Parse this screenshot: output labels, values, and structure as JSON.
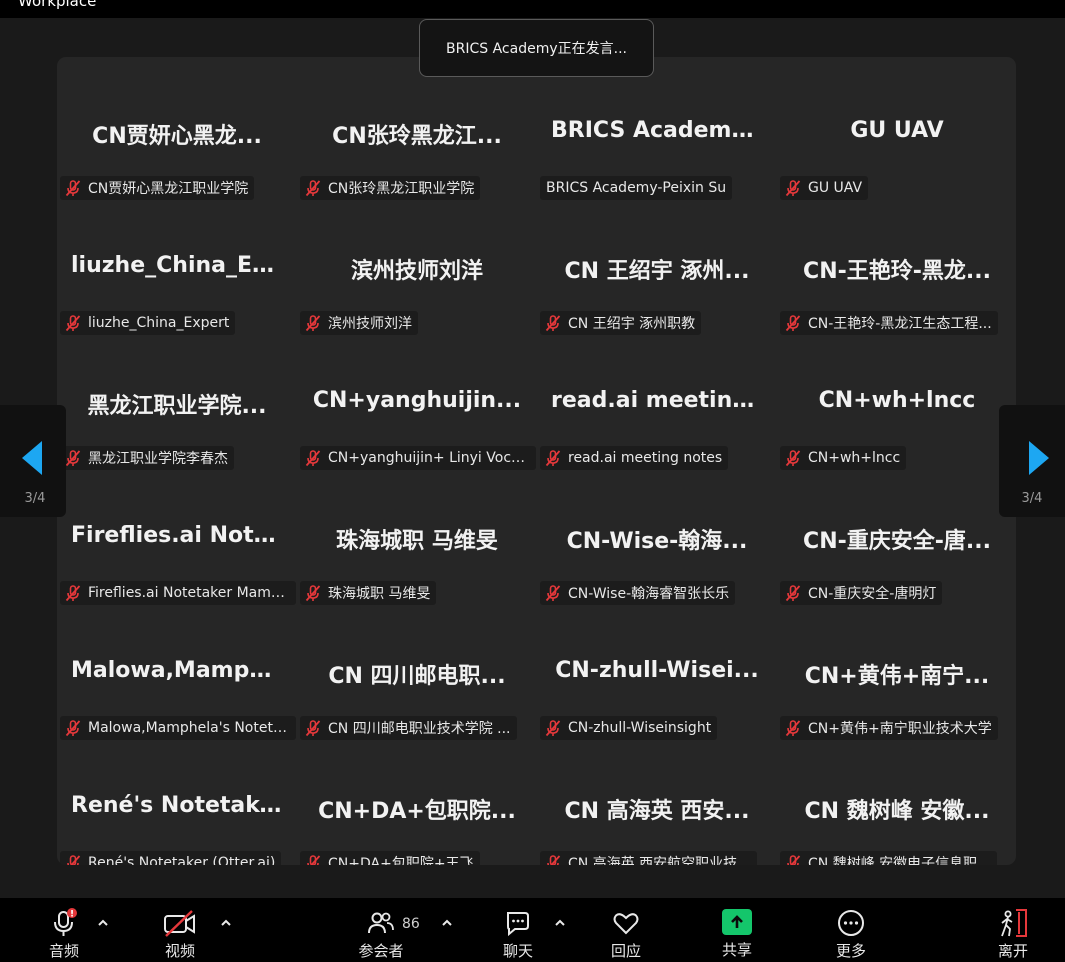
{
  "app": {
    "title": "Workplace"
  },
  "speaker": {
    "banner": "BRICS Academy正在发言..."
  },
  "pagination": {
    "current": "3/4"
  },
  "tiles": [
    {
      "display": "CN贾妍心黑龙...",
      "name": "CN贾妍心黑龙江职业学院",
      "muted": true
    },
    {
      "display": "CN张玲黑龙江...",
      "name": "CN张玲黑龙江职业学院",
      "muted": true
    },
    {
      "display": "BRICS  Academy...",
      "name": "BRICS Academy-Peixin Su",
      "muted": false
    },
    {
      "display": "GU UAV",
      "name": "GU UAV",
      "muted": true
    },
    {
      "display": "liuzhe_China_Ex...",
      "name": "liuzhe_China_Expert",
      "muted": true
    },
    {
      "display": "滨州技师刘洋",
      "name": "滨州技师刘洋",
      "muted": true
    },
    {
      "display": "CN 王绍宇 涿州...",
      "name": "CN 王绍宇 涿州职教",
      "muted": true
    },
    {
      "display": "CN-王艳玲-黑龙...",
      "name": "CN-王艳玲-黑龙江生态工程...",
      "muted": true
    },
    {
      "display": "黑龙江职业学院...",
      "name": "黑龙江职业学院李春杰",
      "muted": true
    },
    {
      "display": "CN+yanghuijin...",
      "name": "CN+yanghuijin+ Linyi Vocat...",
      "muted": true
    },
    {
      "display": "read.ai  meeting...",
      "name": "read.ai meeting notes",
      "muted": true
    },
    {
      "display": "CN+wh+lncc",
      "name": "CN+wh+lncc",
      "muted": true
    },
    {
      "display": "Fireflies.ai  Note...",
      "name": "Fireflies.ai Notetaker Mamp...",
      "muted": true
    },
    {
      "display": "珠海城职 马维旻",
      "name": "珠海城职 马维旻",
      "muted": true
    },
    {
      "display": "CN-Wise-翰海...",
      "name": "CN-Wise-翰海睿智张长乐",
      "muted": true
    },
    {
      "display": "CN-重庆安全-唐...",
      "name": "CN-重庆安全-唐明灯",
      "muted": true
    },
    {
      "display": "Malowa,Mamph...",
      "name": "Malowa,Mamphela's Noteta...",
      "muted": true
    },
    {
      "display": "CN 四川邮电职...",
      "name": "CN 四川邮电职业技术学院 ...",
      "muted": true
    },
    {
      "display": "CN-zhull-Wisei...",
      "name": "CN-zhull-Wiseinsight",
      "muted": true
    },
    {
      "display": "CN+黄伟+南宁...",
      "name": "CN+黄伟+南宁职业技术大学",
      "muted": true
    },
    {
      "display": "René's  Notetake...",
      "name": "René's Notetaker (Otter.ai)",
      "muted": true
    },
    {
      "display": "CN+DA+包职院...",
      "name": "CN+DA+包职院+王飞",
      "muted": true
    },
    {
      "display": "CN 高海英 西安...",
      "name": "CN 高海英 西安航空职业技...",
      "muted": true
    },
    {
      "display": "CN 魏树峰 安徽...",
      "name": "CN 魏树峰 安徽电子信息职...",
      "muted": true
    }
  ],
  "toolbar": {
    "audio": {
      "label": "音频",
      "icon": "mic-muted-icon",
      "alert": "!"
    },
    "video": {
      "label": "视频",
      "icon": "camera-off-icon"
    },
    "participants": {
      "label": "参会者",
      "count": "86",
      "icon": "people-icon"
    },
    "chat": {
      "label": "聊天",
      "icon": "chat-icon"
    },
    "reactions": {
      "label": "回应",
      "icon": "heart-icon"
    },
    "share": {
      "label": "共享",
      "icon": "share-up-icon",
      "color": "#14c66b"
    },
    "more": {
      "label": "更多",
      "icon": "more-dots-icon"
    },
    "leave": {
      "label": "离开",
      "icon": "leave-icon",
      "color": "#e5383b"
    }
  },
  "colors": {
    "accent": "#1da7f2",
    "mute": "#e5383b",
    "tileBg": "#262626",
    "pageBg": "#1a1a1a"
  }
}
